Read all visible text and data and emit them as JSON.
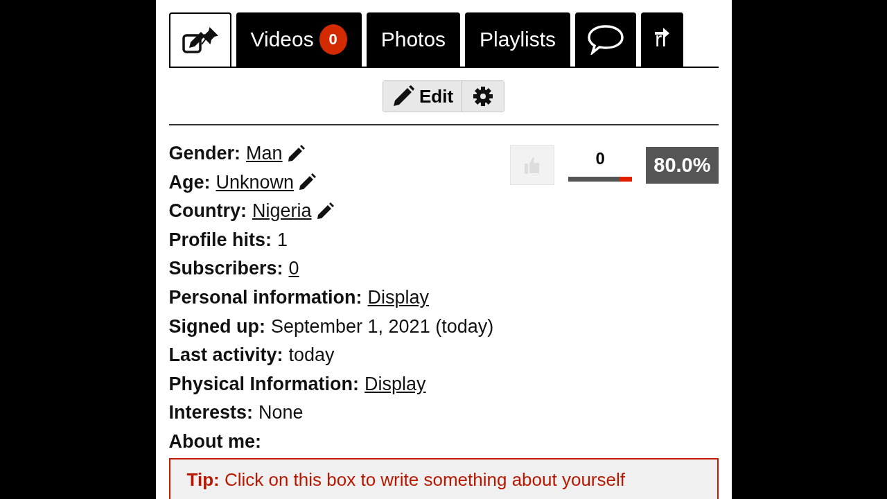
{
  "tabs": [
    {
      "kind": "edit",
      "selected": true
    },
    {
      "kind": "text",
      "label": "Videos",
      "badge": "0",
      "selected": false
    },
    {
      "kind": "text",
      "label": "Photos",
      "selected": false
    },
    {
      "kind": "text",
      "label": "Playlists",
      "selected": false
    },
    {
      "kind": "comments",
      "selected": false
    },
    {
      "kind": "friends",
      "label": "ri",
      "selected": false
    }
  ],
  "toolbar": {
    "edit_label": "Edit"
  },
  "rating": {
    "like_disabled": true,
    "count": "0",
    "level": 0.8,
    "percent": "80.0%"
  },
  "fields": [
    {
      "label": "Gender:",
      "value": "Man",
      "kind": "link",
      "editable": true
    },
    {
      "label": "Age:",
      "value": "Unknown",
      "kind": "link",
      "editable": true
    },
    {
      "label": "Country:",
      "value": "Nigeria",
      "kind": "link",
      "editable": true
    },
    {
      "label": "Profile hits:",
      "value": "1",
      "kind": "text",
      "editable": false
    },
    {
      "label": "Subscribers:",
      "value": "0",
      "kind": "link",
      "editable": false
    },
    {
      "label": "Personal information:",
      "value": "Display",
      "kind": "link",
      "editable": false
    },
    {
      "label": "Signed up:",
      "value": "September 1, 2021 (today)",
      "kind": "text",
      "editable": false
    },
    {
      "label": "Last activity:",
      "value": "today",
      "kind": "text",
      "editable": false
    },
    {
      "label": "Physical Information:",
      "value": "Display",
      "kind": "link",
      "editable": false
    },
    {
      "label": "Interests:",
      "value": "None",
      "kind": "text",
      "editable": false
    },
    {
      "label": "About me:",
      "editable": false
    }
  ],
  "tip": {
    "text": "**Tip:** Click on this box to write something about yourself"
  }
}
